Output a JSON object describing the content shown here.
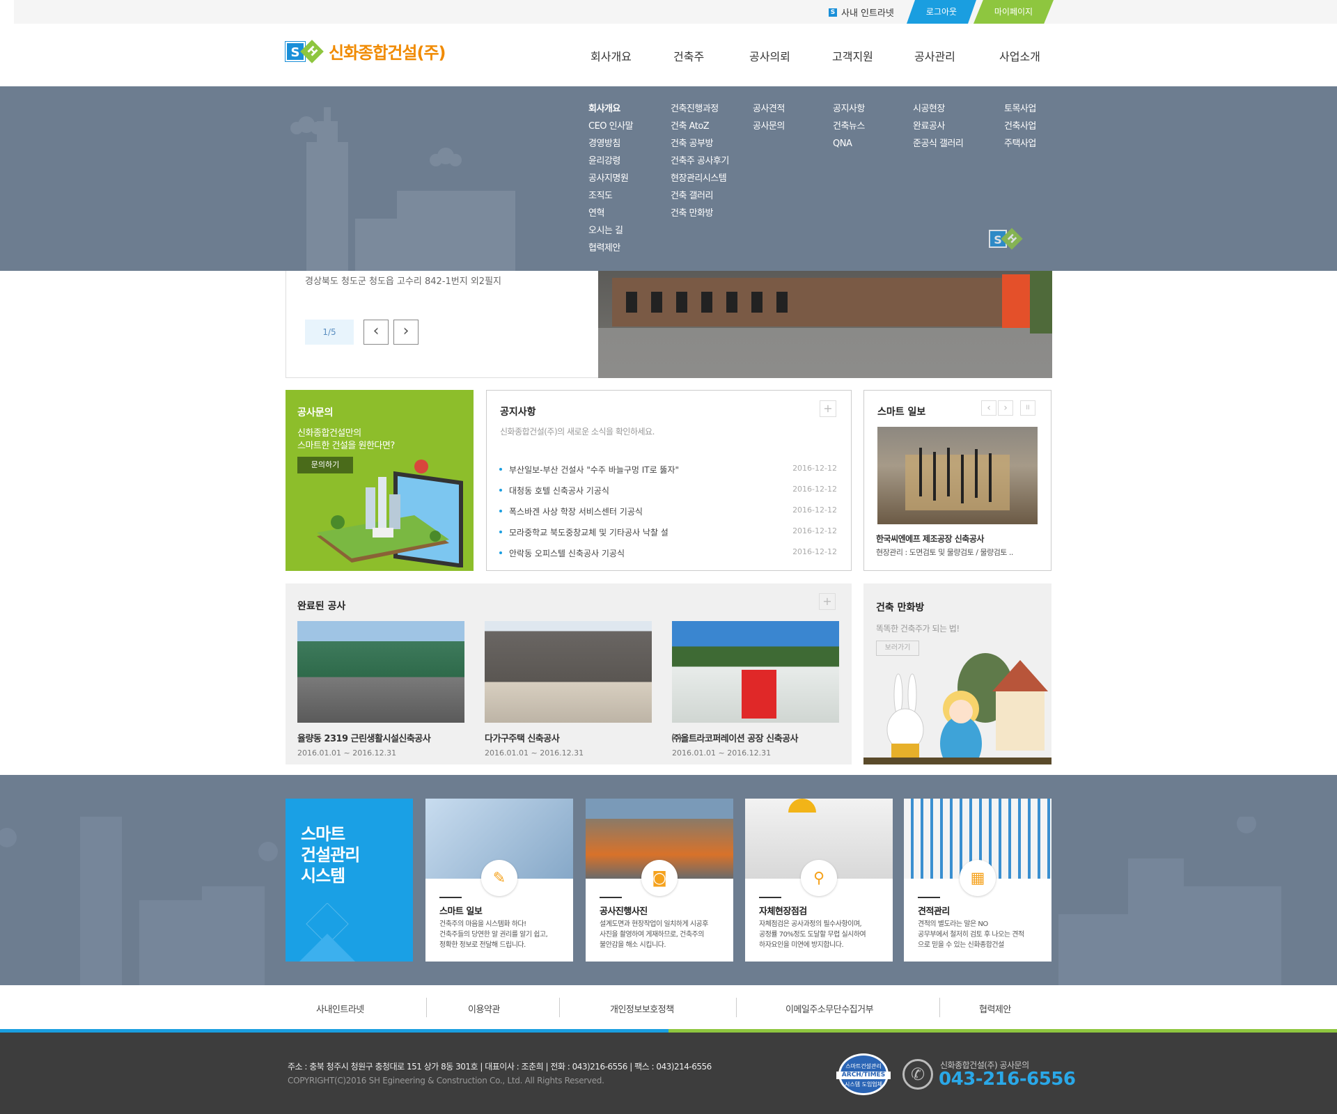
{
  "topbar": {
    "intranet": "사내 인트라넷",
    "logout": "로그아웃",
    "mypage": "마이페이지"
  },
  "logo": {
    "s": "S",
    "h": "H",
    "name": "신화종합건설(주)"
  },
  "gnb": [
    "회사개요",
    "건축주",
    "공사의뢰",
    "고객지원",
    "공사관리",
    "사업소개"
  ],
  "submenu": {
    "company": [
      "회사개요",
      "CEO 인사말",
      "경영방침",
      "윤리강령",
      "공사지명원",
      "조직도",
      "연혁",
      "오시는 길",
      "협력제안"
    ],
    "owner": [
      "건축진행과정",
      "건축 AtoZ",
      "건축 공부방",
      "건축주 공사후기",
      "현장관리시스템",
      "건축 갤러리",
      "건축 만화방"
    ],
    "request": [
      "공사견적",
      "공사문의"
    ],
    "support": [
      "공지사항",
      "건축뉴스",
      "QNA"
    ],
    "manage": [
      "시공현장",
      "완료공사",
      "준공식 갤러리"
    ],
    "business": [
      "토목사업",
      "건축사업",
      "주택사업"
    ]
  },
  "slide": {
    "address": "경상북도 청도군 청도읍 고수리 842-1번지 외2필지",
    "page": "1/5",
    "prev": "‹",
    "next": "›"
  },
  "inquiry": {
    "title": "공사문의",
    "line1": "신화종합건설만의",
    "line2": "스마트한 건설을 원한다면?",
    "button": "문의하기"
  },
  "notice": {
    "title": "공지사항",
    "subtitle": "신화종합건설(주)의 새로운 소식을 확인하세요.",
    "plus": "+",
    "items": [
      {
        "title": "부산일보-부산 건설사 \"수주 바늘구멍 IT로 뚫자\"",
        "date": "2016-12-12"
      },
      {
        "title": "대청동 호텔 신축공사 기공식",
        "date": "2016-12-12"
      },
      {
        "title": "폭스바겐 사상 학장 서비스센터 기공식",
        "date": "2016-12-12"
      },
      {
        "title": "모라중학교 북도중창교체 및 기타공사 낙찰  설",
        "date": "2016-12-12"
      },
      {
        "title": "안락동 오피스텔 신축공사 기공식",
        "date": "2016-12-12"
      }
    ]
  },
  "smart_daily": {
    "title": "스마트 일보",
    "prev": "‹",
    "next": "›",
    "pause": "II",
    "caption": "한국씨엔에프 제조공장 신축공사",
    "desc": "현장관리 : 도면검토 및 물량검토 / 물량검토 .."
  },
  "done": {
    "title": "완료된 공사",
    "plus": "+",
    "items": [
      {
        "name": "율량동 2319 근린생활시설신축공사",
        "date": "2016.01.01 ~ 2016.12.31"
      },
      {
        "name": "다가구주택 신축공사",
        "date": "2016.01.01 ~ 2016.12.31"
      },
      {
        "name": "㈜올트라코퍼레이션 공장 신축공사",
        "date": "2016.01.01 ~ 2016.12.31"
      }
    ]
  },
  "cartoon": {
    "title": "건축 만화방",
    "subtitle": "똑똑한 건축주가 되는 법!",
    "button": "보러가기"
  },
  "system": {
    "title": "스마트\n건설관리\n시스템",
    "cards": [
      {
        "name": "스마트 일보",
        "icon": "phone-pen-icon",
        "desc": "건축주의 마음을 시스템화 하다!\n건축주들의 당연한 알 권리를 알기 쉽고,\n정확한 정보로 전달해 드립니다."
      },
      {
        "name": "공사진행사진",
        "icon": "camera-icon",
        "desc": "설계도면과 현장작업이 일치하게 시공후\n사진을 촬영하여 게재하므로, 건축주의\n불안감을 해소 시킵니다."
      },
      {
        "name": "자체현장점검",
        "icon": "magnifier-person-icon",
        "desc": "자체점검은 공사과정의 필수사항이며,\n공정률 70%정도 도달할 무렵 실시하여\n하자요인을 미연에 방지합니다."
      },
      {
        "name": "견적관리",
        "icon": "calculator-icon",
        "desc": "견적의 별도라는 말은 NO\n공무부에서 철저히 검토 후 나오는 견적\n으로 믿을 수 있는 신화종합건설"
      }
    ]
  },
  "footer_links": [
    "사내인트라넷",
    "이용약관",
    "개인정보보호정책",
    "이메일주소무단수집거부",
    "협력제안"
  ],
  "footer": {
    "address": "주소 : 충북 청주시 청원구 충청대로 151 상가 8동 301호  |  대표이사 : 조춘희  |  전화 : 043)216-6556  |  팩스 : 043)214-6556",
    "copyright": "COPYRIGHT(C)2016  SH Egineering & Construction  Co., Ltd. All Rights Reserved.",
    "badge_top": "스마트건설관리",
    "badge_mid": "ARCH/TIMES",
    "badge_bot": "시스템 도입업체",
    "tel_label": "신화종합건설(주) 공사문의",
    "tel": "043-216-6556"
  },
  "colors": {
    "blue": "#1a9ee0",
    "green": "#8ec63f",
    "orange": "#f08a00",
    "slate": "#6d7d90"
  }
}
